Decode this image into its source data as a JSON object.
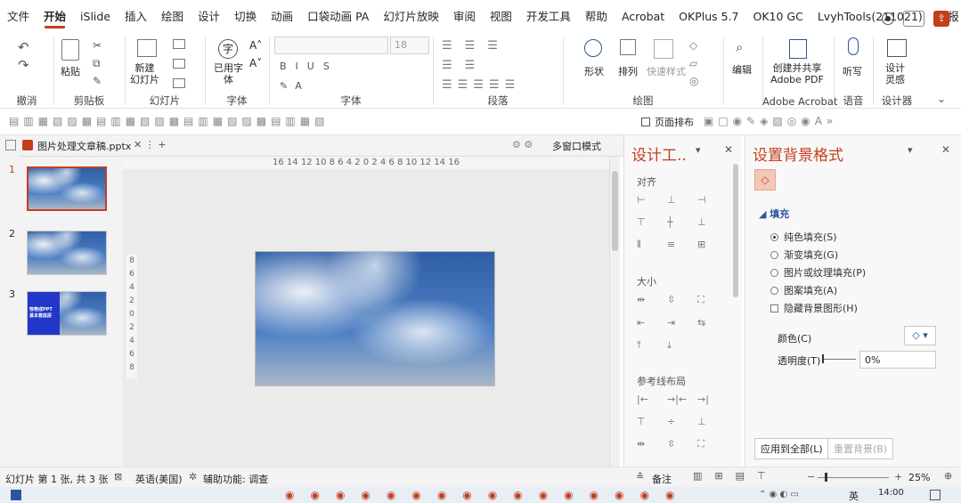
{
  "menu": [
    "文件",
    "开始",
    "iSlide",
    "插入",
    "绘图",
    "设计",
    "切换",
    "动画",
    "口袋动画 PA",
    "幻灯片放映",
    "审阅",
    "视图",
    "开发工具",
    "帮助",
    "Acrobat",
    "OKPlus 5.7",
    "OK10 GC",
    "LvyhTools(211021)",
    "简报"
  ],
  "ribbon": {
    "groups": {
      "undo": "撤消",
      "clipboard": "剪贴板",
      "slides": "幻灯片",
      "font": "字体",
      "font2": "字体",
      "paragraph": "段落",
      "drawing": "绘图",
      "acrobat": "Adobe Acrobat",
      "voice": "语音",
      "designer": "设计器"
    },
    "paste": "粘贴",
    "new_slide": "新建\n幻灯片",
    "used_font": "已用字\n体",
    "font_size": "18",
    "shape": "形状",
    "arrange": "排列",
    "quick_style": "快速样式",
    "edit": "编辑",
    "create_share": "创建并共享\nAdobe PDF",
    "listen": "听写",
    "design_inspiration": "设计\n灵感"
  },
  "qa": {
    "page_sort": "页面排布"
  },
  "tab": {
    "file": "图片处理文章稿.pptx",
    "multiwin": "多窗口模式"
  },
  "ruler": {
    "h": "16 14 12 10 8 6 4 2 0 2 4 6 8 10 12 14 16",
    "v": [
      "8",
      "6",
      "4",
      "2",
      "0",
      "2",
      "4",
      "6",
      "8"
    ]
  },
  "slides": [
    {
      "num": "1"
    },
    {
      "num": "2"
    },
    {
      "num": "3",
      "title": "惊艳成PPT",
      "subtitle": "基本套底层"
    }
  ],
  "design_panel": {
    "title": "设计工..",
    "align": "对齐",
    "size": "大小",
    "guides": "参考线布局"
  },
  "format_panel": {
    "title": "设置背景格式",
    "section": "填充",
    "options": [
      "纯色填充(S)",
      "渐变填充(G)",
      "图片或纹理填充(P)",
      "图案填充(A)"
    ],
    "hide_bg": "隐藏背景图形(H)",
    "color_label": "颜色(C)",
    "transparency_label": "透明度(T)",
    "transparency_value": "0%",
    "apply_all": "应用到全部(L)",
    "reset": "重置背景(B)"
  },
  "status": {
    "slide_info": "幻灯片 第 1 张, 共 3 张",
    "language": "英语(美国)",
    "accessibility": "辅助功能: 调查",
    "notes": "备注",
    "zoom": "25%"
  },
  "taskbar": {
    "time": "14:00",
    "lang": "英"
  },
  "colors": {
    "accent": "#c43e1c",
    "bluetext": "#2b579a"
  }
}
